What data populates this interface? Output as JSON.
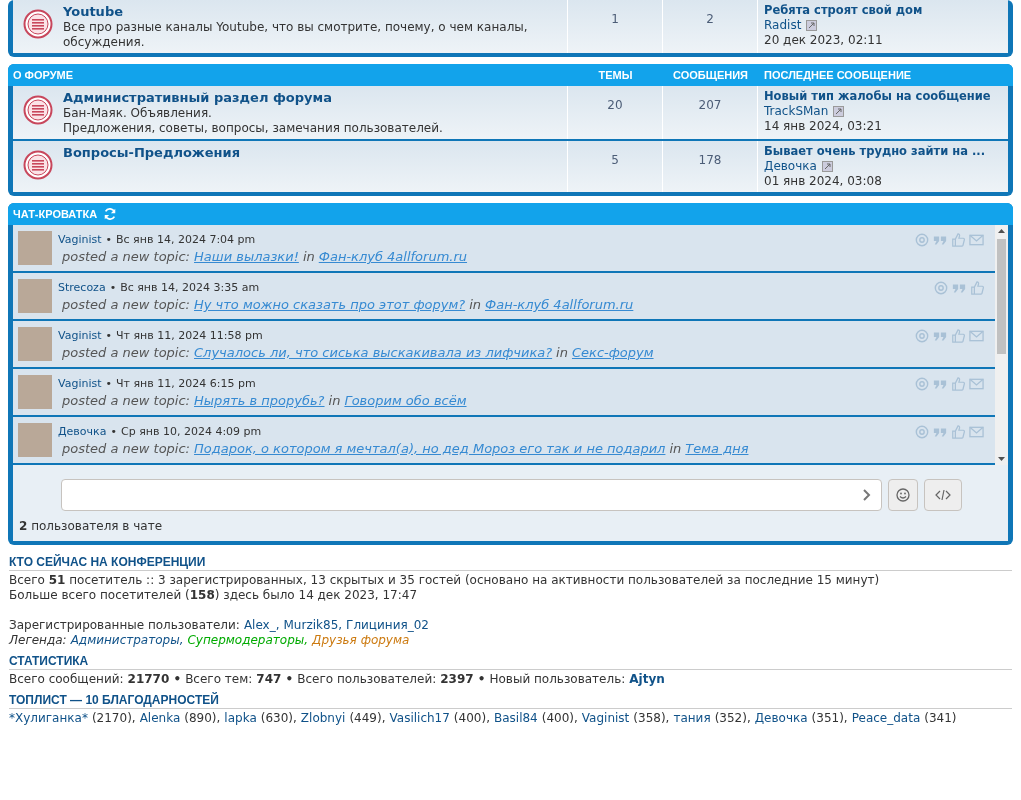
{
  "forum_blocks": [
    {
      "forums": [
        {
          "title": "Youtube",
          "description": [
            "Все про разные каналы Youtube, что вы смотрите, почему, о чем каналы, обсуждения."
          ],
          "topics": "1",
          "posts": "2",
          "last_post": {
            "title": "Ребята строят свой дом",
            "author": "Radist",
            "date": "20 дек 2023, 02:11"
          }
        }
      ]
    },
    {
      "header": {
        "title": "О ФОРУМЕ",
        "topics": "ТЕМЫ",
        "posts": "СООБЩЕНИЯ",
        "last_post": "ПОСЛЕДНЕЕ СООБЩЕНИЕ"
      },
      "forums": [
        {
          "title": "Административный раздел форума",
          "description": [
            "Бан-Маяк. Объявления.",
            "Предложения, советы, вопросы, замечания пользователей."
          ],
          "topics": "20",
          "posts": "207",
          "last_post": {
            "title": "Новый тип жалобы на сообщение",
            "author": "TrackSMan",
            "date": "14 янв 2024, 03:21"
          }
        },
        {
          "title": "Вопросы-Предложения",
          "topics": "5",
          "posts": "178",
          "last_post": {
            "title": "Бывает очень трудно зайти на ...",
            "author": "Девочка",
            "date": "01 янв 2024, 03:08"
          }
        }
      ]
    }
  ],
  "chat": {
    "title": "ЧАТ-КРОВАТКА",
    "messages": [
      {
        "author": "Vaginist",
        "separator": "•",
        "date": "Вс янв 14, 2024 7:04 pm",
        "action": "posted a new topic:",
        "topic": "Наши вылазки!",
        "in": "in",
        "forum": "Фан-клуб 4allforum.ru",
        "can_message": true
      },
      {
        "author": "Strecoza",
        "separator": "•",
        "date": "Вс янв 14, 2024 3:35 am",
        "action": "posted a new topic:",
        "topic": "Ну что можно сказать про этот форум?",
        "in": "in",
        "forum": "Фан-клуб 4allforum.ru",
        "can_message": false
      },
      {
        "author": "Vaginist",
        "separator": "•",
        "date": "Чт янв 11, 2024 11:58 pm",
        "action": "posted a new topic:",
        "topic": "Случалось ли, что сиська выскакивала из лифчика?",
        "in": "in",
        "forum": "Секс-форум",
        "can_message": true
      },
      {
        "author": "Vaginist",
        "separator": "•",
        "date": "Чт янв 11, 2024 6:15 pm",
        "action": "posted a new topic:",
        "topic": "Нырять в прорубь?",
        "in": "in",
        "forum": "Говорим обо всём",
        "can_message": true
      },
      {
        "author": "Девочка",
        "separator": "•",
        "date": "Ср янв 10, 2024 4:09 pm",
        "action": "posted a new topic:",
        "topic": "Подарок, о котором я мечтал(а), но дед Мороз его так и не подарил",
        "in": "in",
        "forum": "Тема дня",
        "can_message": true
      }
    ],
    "users_online": "**2** пользователя в чате"
  },
  "who_online": {
    "title": "КТО СЕЙЧАС НА КОНФЕРЕНЦИИ",
    "lines": [
      "Всего **51** посетитель :: 3 зарегистрированных, 13 скрытых и 35 гостей (основано на активности пользователей за последние 15 минут)",
      "Больше всего посетителей (**158**) здесь было 14 дек 2023, 17:47"
    ],
    "registered_label": "Зарегистрированные пользователи:",
    "registered": [
      "Alex_,",
      "Murzik85,",
      "Глициния_02"
    ],
    "legend_label": "Легенда:",
    "legend": [
      {
        "name": "Администраторы,",
        "color": "#105289"
      },
      {
        "name": "Супермодераторы,",
        "color": "#00aa00"
      },
      {
        "name": "Друзья форума",
        "color": "#cc7a10"
      }
    ]
  },
  "statistics": {
    "title": "СТАТИСТИКА",
    "items": [
      {
        "label": "Всего сообщений:",
        "value": "21770 •"
      },
      {
        "label": "Всего тем:",
        "value": "747 •"
      },
      {
        "label": "Всего пользователей:",
        "value": "2397 •"
      }
    ],
    "new_user_label": "Новый пользователь:",
    "new_user": "Ajtyn"
  },
  "toplist": {
    "title": "ТОПЛИСТ — 10 БЛАГОДАРНОСТЕЙ",
    "items": [
      {
        "name": "*Хулиганка*",
        "count": "(2170),"
      },
      {
        "name": "Alenka",
        "count": "(890),"
      },
      {
        "name": "lapka",
        "count": "(630),"
      },
      {
        "name": "Zlobnyi",
        "count": "(449),"
      },
      {
        "name": "Vasilich17",
        "count": "(400),"
      },
      {
        "name": "Basil84",
        "count": "(400),"
      },
      {
        "name": "Vaginist",
        "count": "(358),"
      },
      {
        "name": "тания",
        "count": "(352),"
      },
      {
        "name": "Девочка",
        "count": "(351),"
      },
      {
        "name": "Peace_data",
        "count": "(341)"
      }
    ]
  }
}
